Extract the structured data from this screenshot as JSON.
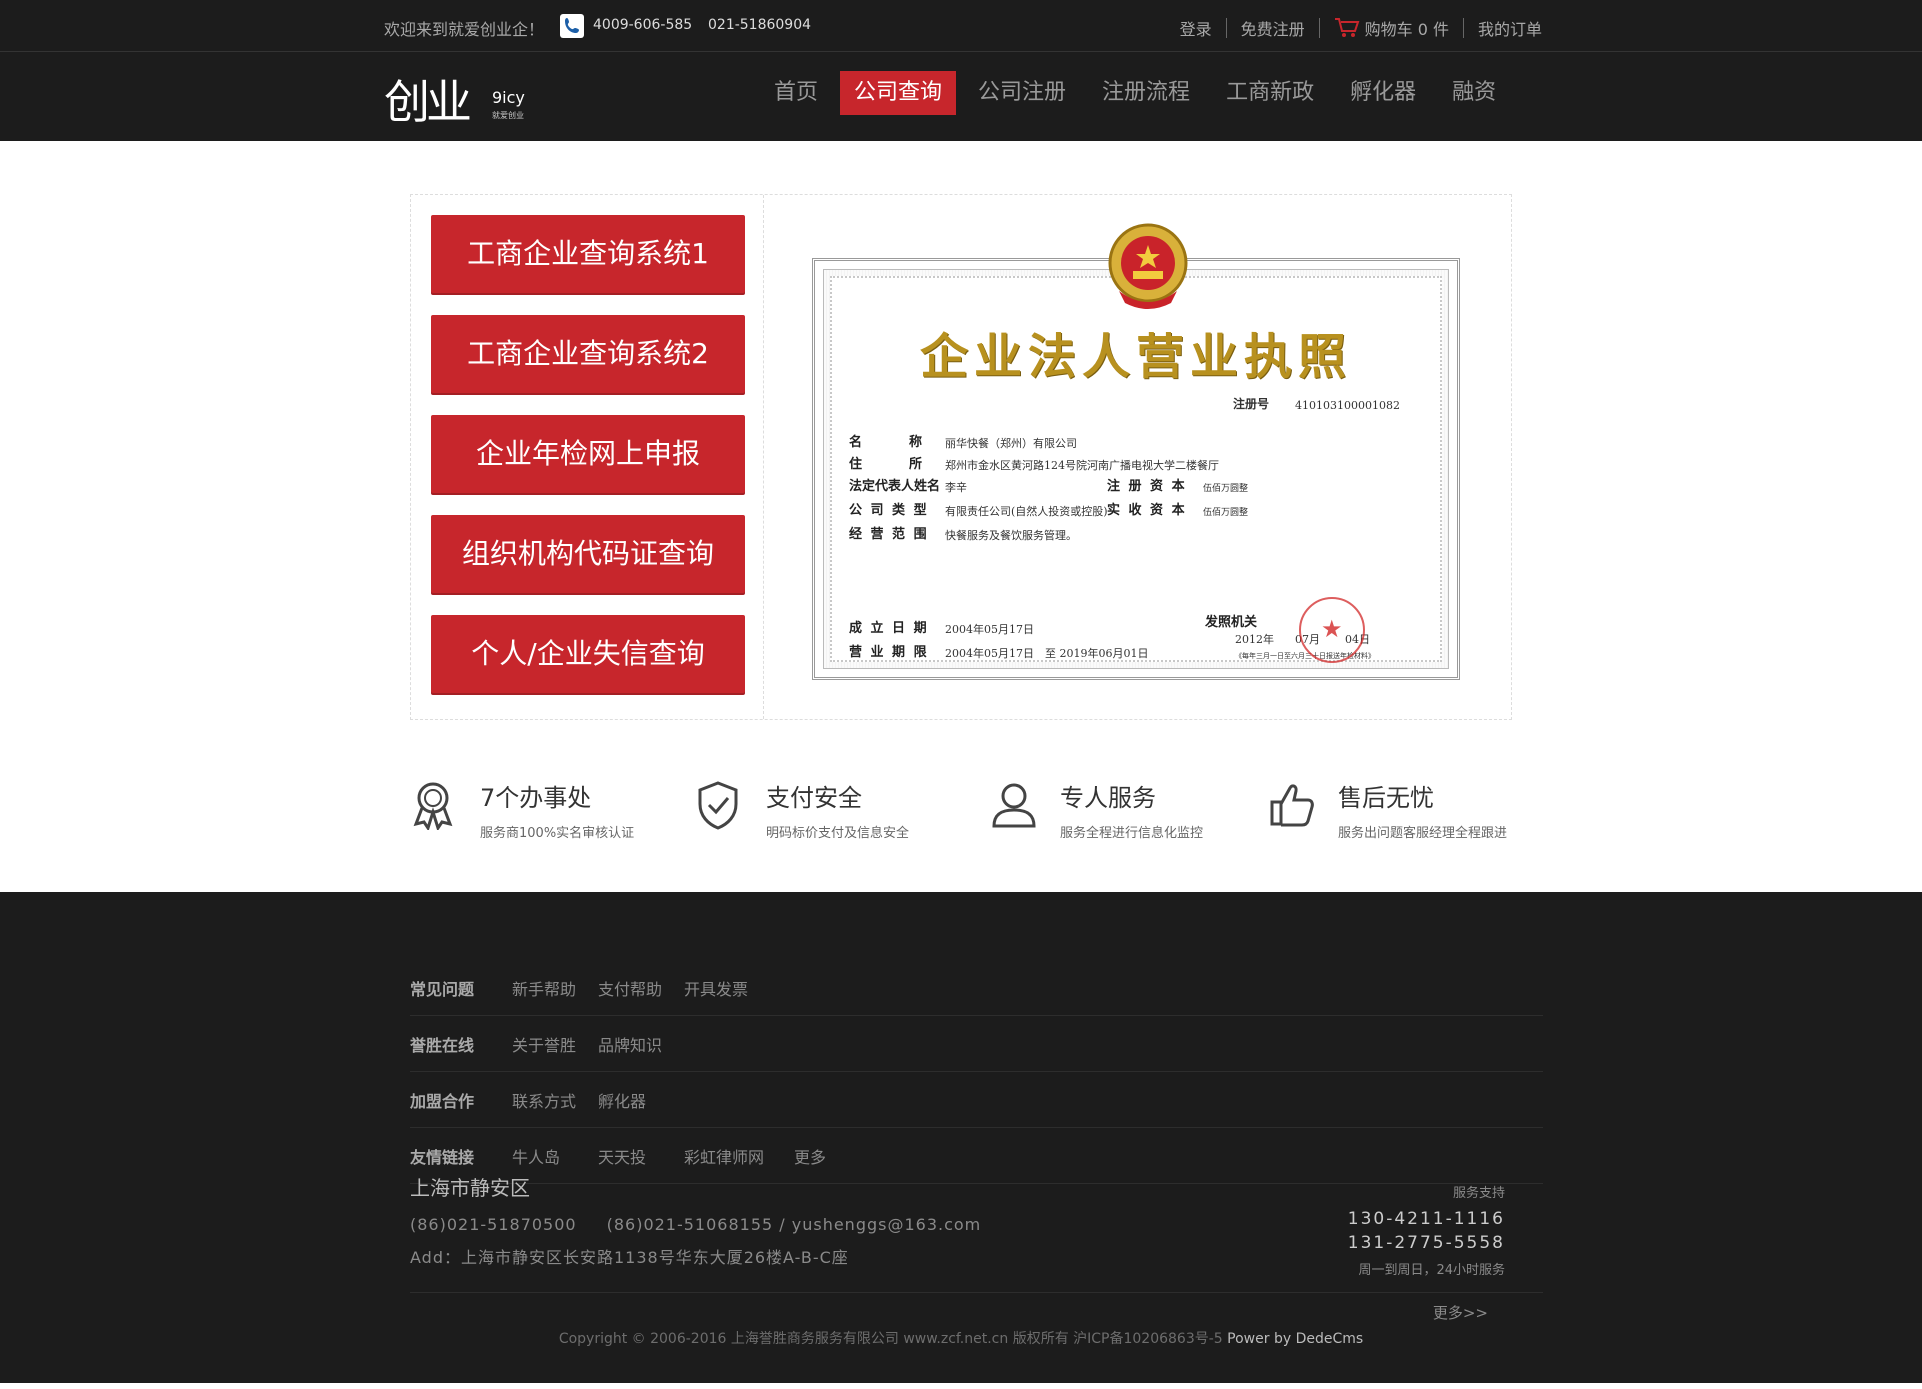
{
  "topbar": {
    "welcome": "欢迎来到就爱创业企！",
    "phone1": "4009-606-585",
    "phone2": "021-51860904",
    "login": "登录",
    "register": "免费注册",
    "cart": "购物车 0 件",
    "orders": "我的订单"
  },
  "logo": {
    "glyph": "创业",
    "en": "9icy",
    "cn": "就爱创业"
  },
  "nav": {
    "items": [
      "首页",
      "公司查询",
      "公司注册",
      "注册流程",
      "工商新政",
      "孵化器",
      "融资"
    ],
    "active": "公司查询"
  },
  "query": {
    "buttons": [
      "工商企业查询系统1",
      "工商企业查询系统2",
      "企业年检网上申报",
      "组织机构代码证查询",
      "个人/企业失信查询"
    ]
  },
  "certificate": {
    "title": "企业法人营业执照",
    "reg_label": "注册号",
    "reg_no": "410103100001082",
    "fields": {
      "name_label": "名　　　称",
      "name": "丽华快餐（郑州）有限公司",
      "address_label": "住　　　所",
      "address": "郑州市金水区黄河路124号院河南广播电视大学二楼餐厅",
      "rep_label": "法定代表人姓名",
      "rep": "李辛",
      "capital_label": "注 册 资 本",
      "capital": "伍佰万圆整",
      "type_label": "公 司 类 型",
      "type": "有限责任公司(自然人投资或控股)",
      "paid_label": "实 收 资 本",
      "paid": "伍佰万圆整",
      "scope_label": "经 营 范 围",
      "scope": "快餐服务及餐饮服务管理。",
      "founded_label": "成 立 日 期",
      "founded": "2004年05月17日",
      "term_label": "营 业 期 限",
      "term": "2004年05月17日　至 2019年06月01日",
      "issuer_label": "发照机关",
      "issue_year": "2012年",
      "issue_month": "07月",
      "issue_day": "04日",
      "note": "《每年三月一日至六月三十日报送年检材料》"
    }
  },
  "features": [
    {
      "icon": "award-ribbon-icon",
      "title": "7个办事处",
      "sub": "服务商100%实名审核认证"
    },
    {
      "icon": "shield-check-icon",
      "title": "支付安全",
      "sub": "明码标价支付及信息安全"
    },
    {
      "icon": "user-icon",
      "title": "专人服务",
      "sub": "服务全程进行信息化监控"
    },
    {
      "icon": "thumbs-up-icon",
      "title": "售后无忧",
      "sub": "服务出问题客服经理全程跟进"
    }
  ],
  "footer": {
    "rows": [
      {
        "heading": "常见问题",
        "links": [
          "新手帮助",
          "支付帮助",
          "开具发票"
        ]
      },
      {
        "heading": "誉胜在线",
        "links": [
          "关于誉胜",
          "品牌知识"
        ]
      },
      {
        "heading": "加盟合作",
        "links": [
          "联系方式",
          "孵化器"
        ]
      },
      {
        "heading": "友情链接",
        "links": [
          "牛人岛",
          "天天投",
          "彩虹律师网",
          "更多"
        ]
      }
    ],
    "city": "上海市静安区",
    "tel1": "(86)021-51870500",
    "tel2": "(86)021-51068155 / yushenggs@163.com",
    "address": "Add：上海市静安区长安路1138号华东大厦26楼A-B-C座",
    "support_label": "服务支持",
    "support1": "130-4211-1116",
    "support2": "131-2775-5558",
    "support_hours": "周一到周日，24小时服务",
    "more": "更多>>",
    "copyright": "Copyright © 2006-2016 上海誉胜商务服务有限公司 www.zcf.net.cn  版权所有  沪ICP备10206863号-5 ",
    "power": "Power by DedeCms"
  },
  "colors": {
    "accent": "#c7262c",
    "dark": "#1c1c1c",
    "gold": "#b8911f"
  }
}
